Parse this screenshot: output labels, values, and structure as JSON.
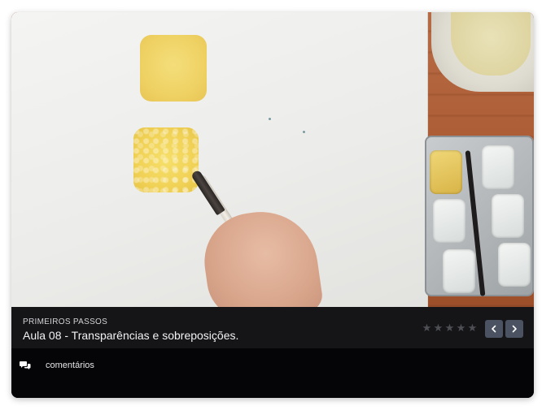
{
  "video": {
    "thumbnail_icon": "watercolor-painting-scene"
  },
  "lesson": {
    "section": "PRIMEIROS PASSOS",
    "title": "Aula 08 - Transparências e sobreposições.",
    "rating": 0,
    "max_rating": 5
  },
  "nav": {
    "prev_icon": "chevron-left-icon",
    "next_icon": "chevron-right-icon"
  },
  "comments": {
    "icon": "chat-bubbles-icon",
    "label": "comentários"
  },
  "colors": {
    "infobar_bg": "#151518",
    "comments_bg": "#050507",
    "nav_button_bg": "#4b5363",
    "star_empty": "#4e4f55"
  }
}
